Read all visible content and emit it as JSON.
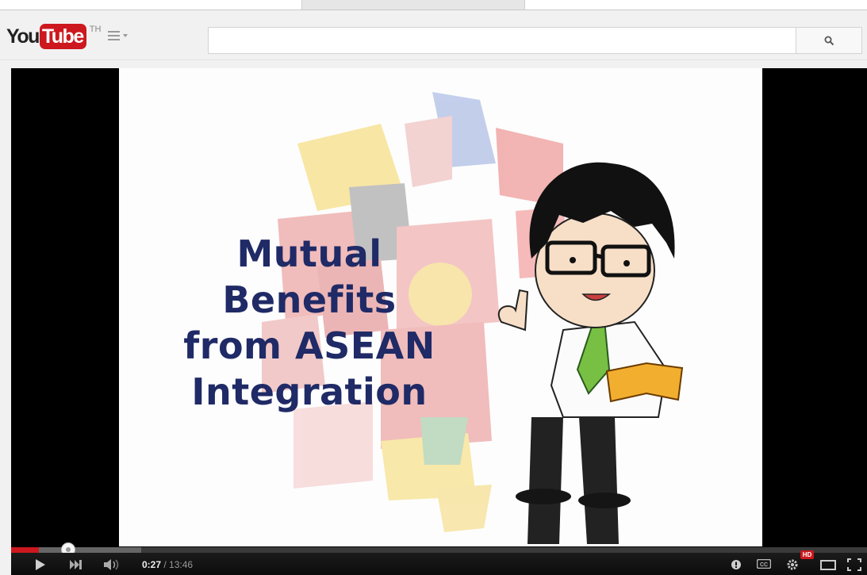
{
  "masthead": {
    "logo_you": "You",
    "logo_tube": "Tube",
    "country_code": "TH",
    "search": {
      "value": "",
      "placeholder": ""
    },
    "icons": {
      "guide": "guide-menu-icon",
      "search": "search-icon"
    }
  },
  "video": {
    "title_lines": [
      "Mutual",
      "Benefits",
      "from ASEAN",
      "Integration"
    ]
  },
  "player": {
    "current_time": "0:27",
    "separator": " / ",
    "duration": "13:46",
    "progress_fraction": 0.0327,
    "buffered_fraction": 0.152,
    "hd_badge": "HD",
    "icons": [
      "play-icon",
      "next-icon",
      "volume-icon",
      "annotations-icon",
      "captions-icon",
      "settings-icon",
      "size-toggle-icon",
      "fullscreen-icon"
    ],
    "colors": {
      "played": "#cc181e",
      "hd": "#cc181e"
    }
  }
}
